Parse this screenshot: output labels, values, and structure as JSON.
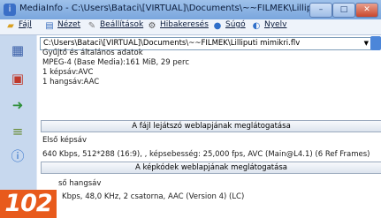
{
  "window": {
    "title": "MediaInfo - C:\\Users\\Bataci\\[VIRTUAL]\\Documents\\~~FILMEK\\Lilliputi mimikri.flv",
    "buttons": {
      "minimize": "–",
      "maximize": "□",
      "close": "✕"
    }
  },
  "menu": [
    {
      "label": "Fájl",
      "icon": "folder-icon"
    },
    {
      "label": "Nézet",
      "icon": "view-icon"
    },
    {
      "label": "Beállítások",
      "icon": "settings-icon"
    },
    {
      "label": "Hibakeresés",
      "icon": "debug-icon"
    },
    {
      "label": "Súgó",
      "icon": "help-icon"
    },
    {
      "label": "Nyelv",
      "icon": "language-icon"
    }
  ],
  "file_select": {
    "value": "C:\\Users\\Bataci\\[VIRTUAL]\\Documents\\~~FILMEK\\Lilliputi mimikri.flv"
  },
  "general": {
    "heading": "Gyűjtő és általános adatok",
    "line1": "MPEG-4 (Base Media):161 MiB, 29 perc",
    "line2": "1 képsáv:AVC",
    "line3": "1 hangsáv:AAC"
  },
  "player_button": "A fájl lejátszó weblapjának meglátogatása",
  "video": {
    "heading": "Első képsáv",
    "details": "640 Kbps, 512*288 (16:9), , képsebesség: 25,000 fps, AVC (Main@L4.1) (6 Ref Frames)"
  },
  "codec_button": "A képkódek weblapjának meglátogatása",
  "audio": {
    "heading": "ső hangsáv",
    "details": "Kbps, 48,0 KHz, 2 csatorna, AAC (Version 4) (LC)"
  },
  "badge": "102",
  "colors": {
    "badge": "#e85a1c",
    "sidebar": "#c7d8ee",
    "titlebar": "#8fb6e6"
  }
}
